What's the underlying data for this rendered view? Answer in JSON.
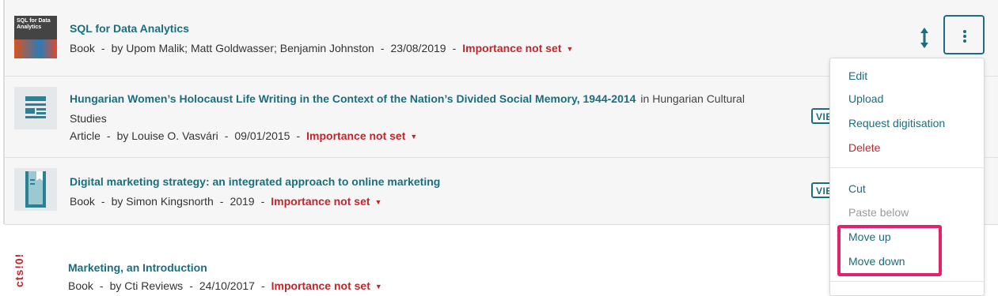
{
  "items": [
    {
      "title": "SQL for Data Analytics",
      "type": "Book",
      "authors": "by Upom Malik; Matt Goldwasser; Benjamin Johnston",
      "date": "23/08/2019",
      "importance": "Importance not set",
      "cover_text": "SQL for Data Analytics"
    },
    {
      "title": "Hungarian Women’s Holocaust Life Writing in the Context of the Nation’s Divided Social Memory, 1944-2014",
      "in_text": "in Hungarian Cultural",
      "in_text_cont": "Studies",
      "type": "Article",
      "authors": "by Louise O. Vasvári",
      "date": "09/01/2015",
      "importance": "Importance not set",
      "view_label": "VIEW"
    },
    {
      "title": "Digital marketing strategy: an integrated approach to online marketing",
      "type": "Book",
      "authors": "by Simon Kingsnorth",
      "date": "2019",
      "importance": "Importance not set",
      "view_label": "VIEW"
    },
    {
      "title": "Marketing, an Introduction",
      "type": "Book",
      "authors": "by Cti Reviews",
      "date": "24/10/2017",
      "importance": "Importance not set",
      "cover_text": "cts!0!"
    }
  ],
  "separator": "-",
  "menu": {
    "edit": "Edit",
    "upload": "Upload",
    "request_digitisation": "Request digitisation",
    "delete": "Delete",
    "cut": "Cut",
    "paste_below": "Paste below",
    "move_up": "Move up",
    "move_down": "Move down"
  },
  "icons": {
    "reorder": "reorder-arrows-icon",
    "kebab": "more-vertical-icon",
    "caret": "caret-down-icon"
  },
  "colors": {
    "link": "#1a6e7f",
    "importance": "#c0262c",
    "highlight": "#e4216d",
    "row_bg": "#f6f6f6"
  }
}
